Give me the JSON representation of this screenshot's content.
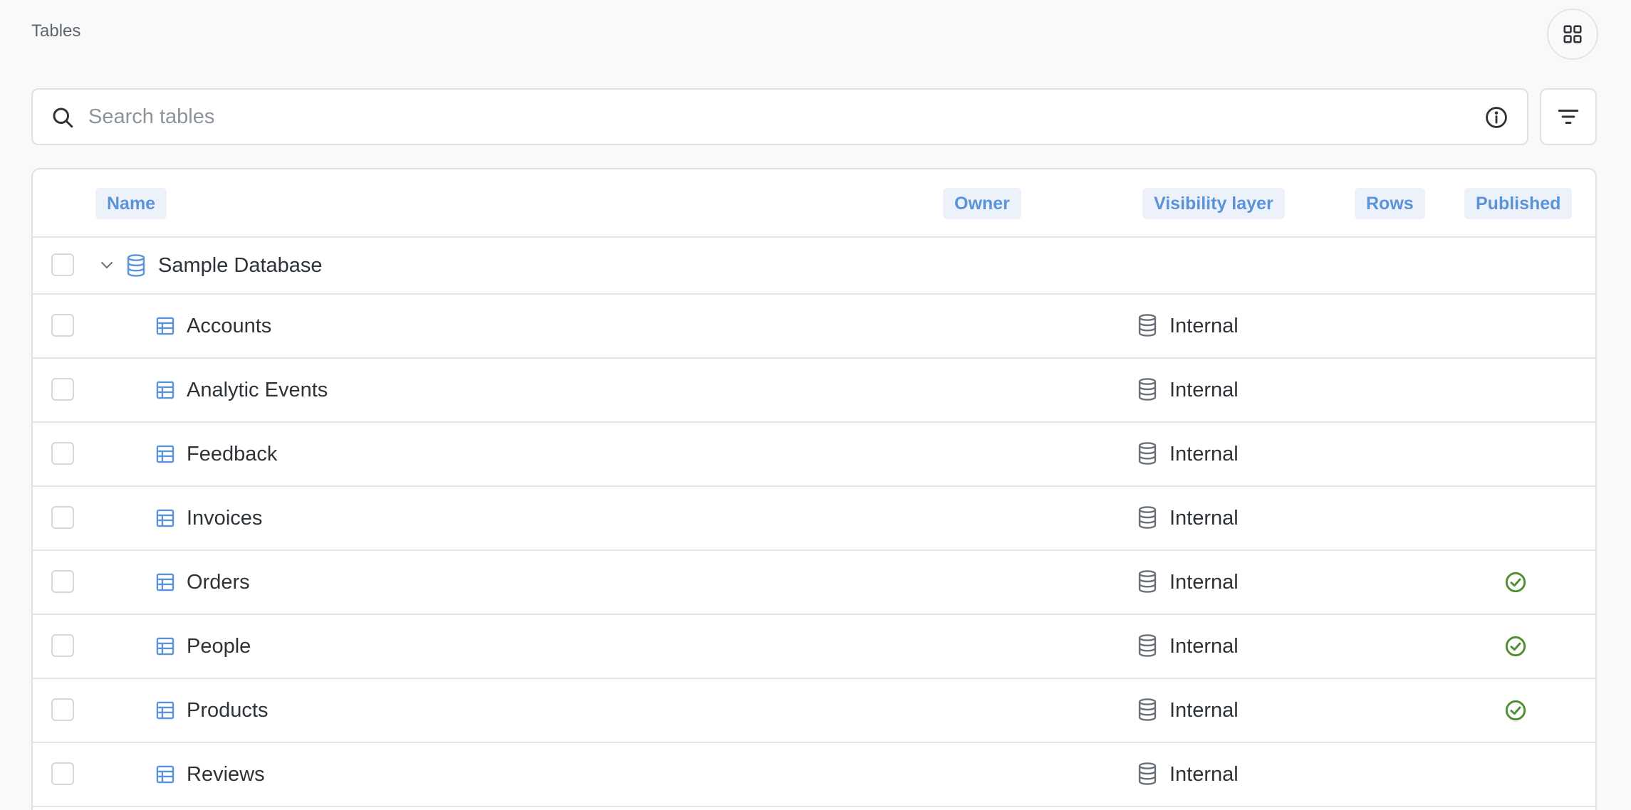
{
  "breadcrumb": "Tables",
  "search": {
    "placeholder": "Search tables"
  },
  "columns": {
    "name": "Name",
    "owner": "Owner",
    "visibility": "Visibility layer",
    "rows": "Rows",
    "published": "Published"
  },
  "database": {
    "name": "Sample Database",
    "expanded": true
  },
  "tables": [
    {
      "name": "Accounts",
      "visibility": "Internal",
      "published": false
    },
    {
      "name": "Analytic Events",
      "visibility": "Internal",
      "published": false
    },
    {
      "name": "Feedback",
      "visibility": "Internal",
      "published": false
    },
    {
      "name": "Invoices",
      "visibility": "Internal",
      "published": false
    },
    {
      "name": "Orders",
      "visibility": "Internal",
      "published": true
    },
    {
      "name": "People",
      "visibility": "Internal",
      "published": true
    },
    {
      "name": "Products",
      "visibility": "Internal",
      "published": true
    },
    {
      "name": "Reviews",
      "visibility": "Internal",
      "published": false
    }
  ],
  "icons": {
    "table": "table-icon",
    "database": "database-icon",
    "published": "check-circle-icon",
    "search": "search-icon",
    "info": "info-icon",
    "filter": "filter-icon",
    "layout": "grid-icon"
  },
  "colors": {
    "accent": "#5a93d9",
    "published_green": "#4f8f2f",
    "header_chip_bg": "#edf2fa"
  }
}
